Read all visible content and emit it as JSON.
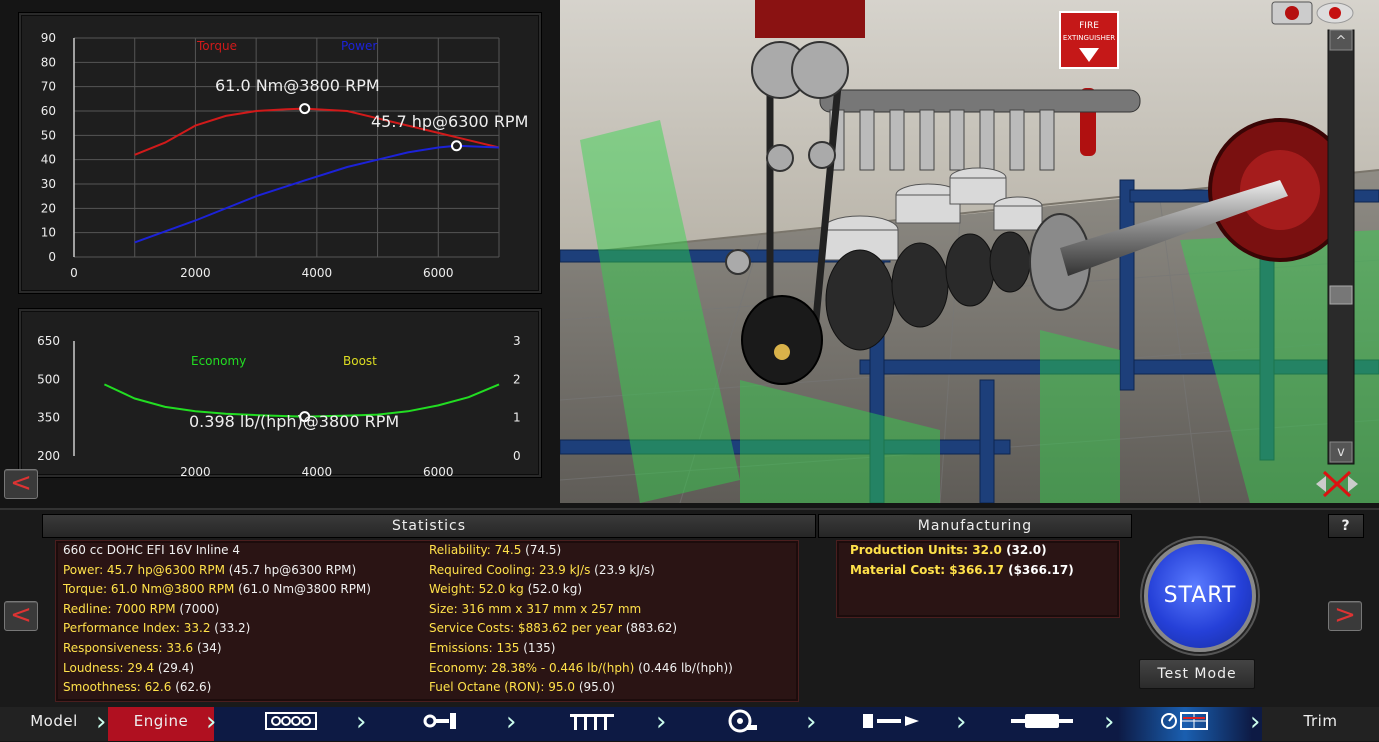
{
  "torque_chart": {
    "legend_torque": "Torque",
    "legend_power": "Power",
    "torque_annotation": "61.0 Nm@3800 RPM",
    "power_annotation": "45.7 hp@6300 RPM",
    "y_ticks": [
      "90",
      "80",
      "70",
      "60",
      "50",
      "40",
      "30",
      "20",
      "10",
      "0"
    ],
    "x_ticks": [
      "0",
      "2000",
      "4000",
      "6000"
    ],
    "torque_color": "#d11a1a",
    "power_color": "#1c22d8"
  },
  "economy_chart": {
    "legend_economy": "Economy",
    "legend_boost": "Boost",
    "economy_annotation": "0.398 lb/(hph)@3800 RPM",
    "y_left_ticks": [
      "650",
      "500",
      "350",
      "200"
    ],
    "y_right_ticks": [
      "3",
      "2",
      "1",
      "0"
    ],
    "x_ticks": [
      "2000",
      "4000",
      "6000"
    ],
    "economy_color": "#22dd22",
    "boost_color": "#dddd22"
  },
  "chart_data": [
    {
      "type": "line",
      "xlim": [
        0,
        7000
      ],
      "ylim": [
        0,
        90
      ],
      "series": [
        {
          "name": "Torque",
          "x": [
            1000,
            1500,
            2000,
            2500,
            3000,
            3500,
            3800,
            4500,
            5000,
            5500,
            6000,
            6500,
            7000
          ],
          "y": [
            42,
            47,
            54,
            58,
            60,
            60.7,
            61,
            60,
            57,
            54,
            51,
            48,
            45
          ]
        },
        {
          "name": "Power",
          "x": [
            1000,
            2000,
            3000,
            3800,
            4500,
            5000,
            5500,
            6000,
            6300,
            6700,
            7000
          ],
          "y": [
            6,
            15,
            25,
            31.5,
            37,
            40,
            43,
            45,
            45.7,
            45.3,
            45
          ]
        }
      ],
      "points": [
        {
          "x": 3800,
          "y": 61
        },
        {
          "x": 6300,
          "y": 45.7
        }
      ]
    },
    {
      "type": "line",
      "xlim": [
        0,
        7000
      ],
      "ylim": [
        200,
        650
      ],
      "series": [
        {
          "name": "Economy",
          "x": [
            500,
            1000,
            1500,
            2000,
            2500,
            3000,
            3500,
            3800,
            4500,
            5000,
            5500,
            6000,
            6500,
            7000
          ],
          "y": [
            480,
            425,
            392,
            375,
            365,
            360,
            356,
            354,
            358,
            362,
            375,
            398,
            430,
            480
          ]
        }
      ],
      "points": [
        {
          "x": 3800,
          "y": 354
        }
      ]
    }
  ],
  "viewport": {
    "fire_sign_line1": "FIRE",
    "fire_sign_line2": "EXTINGUISHER",
    "scroll_up": "^",
    "scroll_down": "v"
  },
  "statistics": {
    "header": "Statistics",
    "left": [
      {
        "label": "660 cc DOHC EFI 16V Inline 4",
        "value": ""
      },
      {
        "label": "Power: 45.7 hp@6300 RPM",
        "value": "(45.7 hp@6300 RPM)"
      },
      {
        "label": "Torque: 61.0 Nm@3800 RPM",
        "value": "(61.0 Nm@3800 RPM)"
      },
      {
        "label": "Redline: 7000 RPM",
        "value": "(7000)"
      },
      {
        "label": "Performance Index: 33.2",
        "value": "(33.2)"
      },
      {
        "label": "Responsiveness: 33.6",
        "value": "(34)"
      },
      {
        "label": "Loudness: 29.4",
        "value": "(29.4)"
      },
      {
        "label": "Smoothness: 62.6",
        "value": "(62.6)"
      }
    ],
    "right": [
      {
        "label": "Reliability: 74.5",
        "value": "(74.5)"
      },
      {
        "label": "Required Cooling: 23.9 kJ/s",
        "value": "(23.9 kJ/s)"
      },
      {
        "label": "Weight: 52.0 kg",
        "value": "(52.0 kg)"
      },
      {
        "label": "Size: 316 mm x 317 mm x 257 mm",
        "value": ""
      },
      {
        "label": "Service Costs: $883.62 per year",
        "value": "(883.62)"
      },
      {
        "label": "Emissions: 135",
        "value": "(135)"
      },
      {
        "label": "Economy: 28.38% - 0.446 lb/(hph)",
        "value": "(0.446 lb/(hph))"
      },
      {
        "label": "Fuel Octane (RON): 95.0",
        "value": "(95.0)"
      }
    ]
  },
  "manufacturing": {
    "header": "Manufacturing",
    "items": [
      {
        "label": "Production Units: 32.0",
        "value": "(32.0)"
      },
      {
        "label": "Material Cost: $366.17",
        "value": "($366.17)"
      }
    ]
  },
  "help_label": "?",
  "start_label": "START",
  "test_mode_label": "Test Mode",
  "prev_label": "<",
  "next_label": ">",
  "nav": {
    "model": "Model",
    "engine": "Engine",
    "trim": "Trim",
    "active_color": "#b01020"
  }
}
